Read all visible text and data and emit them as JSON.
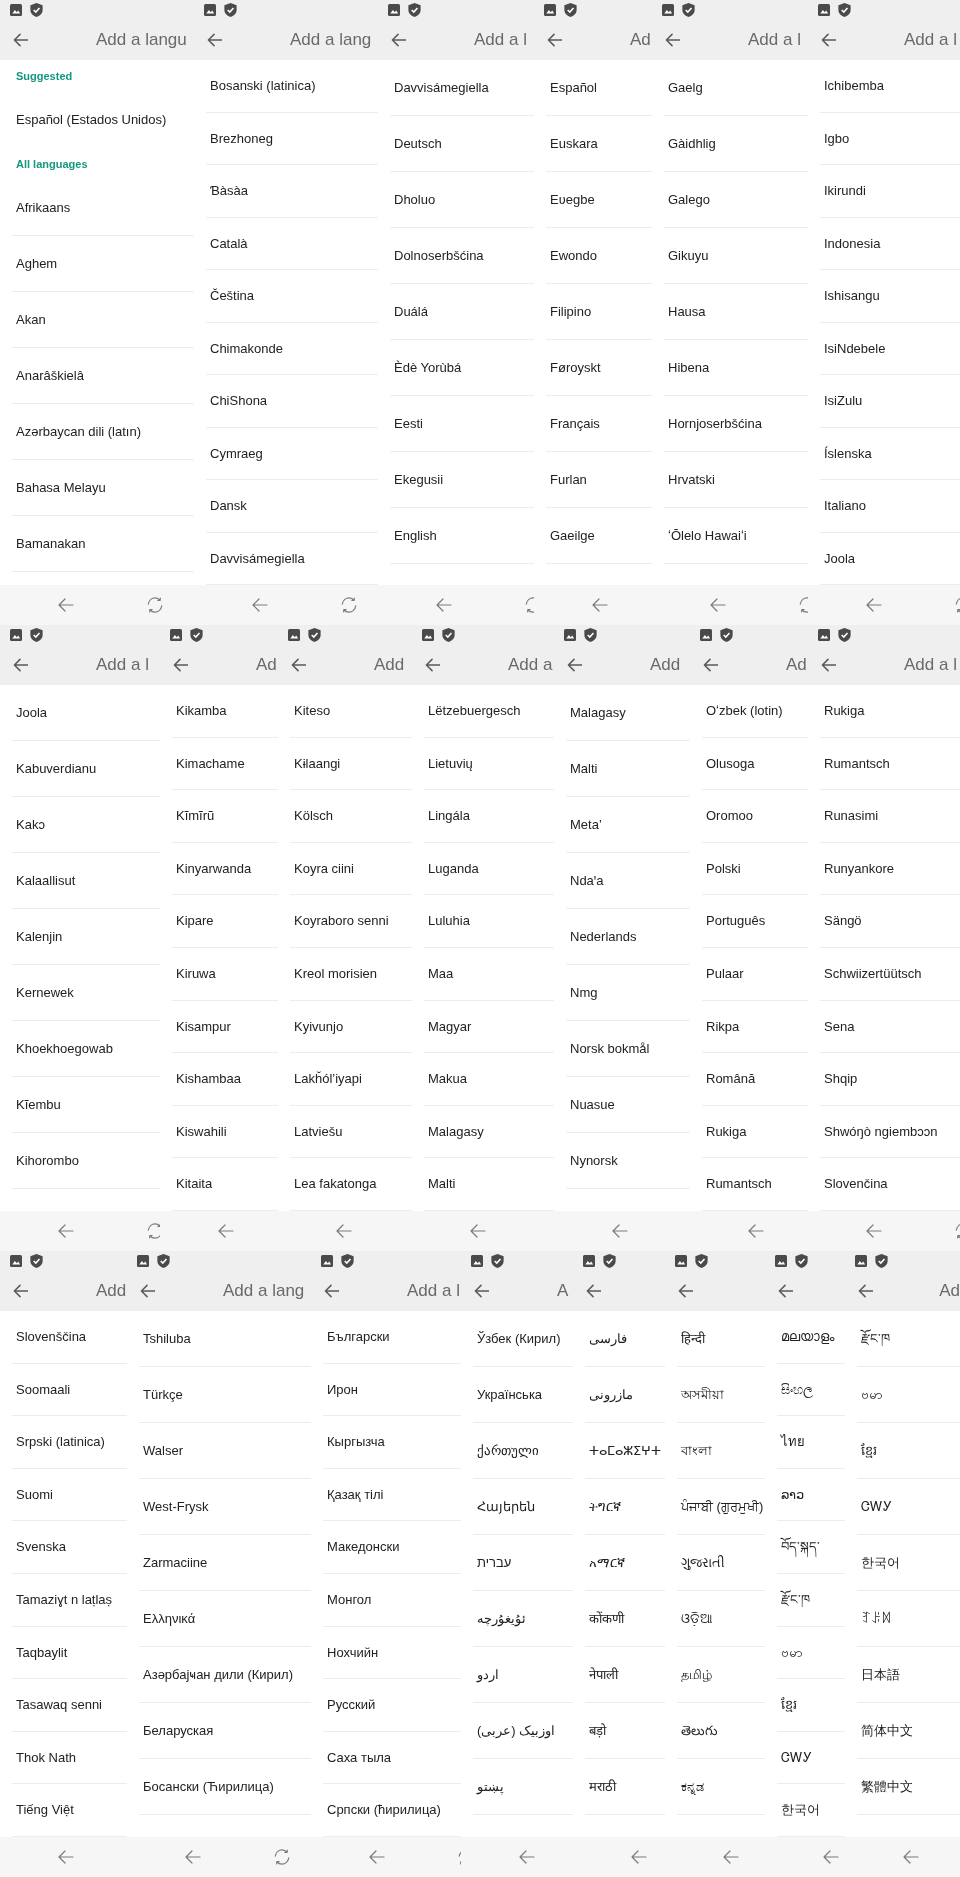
{
  "rows": [
    {
      "screens": [
        {
          "title": "Add a langu",
          "entries": [
            {
              "kind": "header",
              "text": "Suggested"
            },
            {
              "kind": "item",
              "text": "Español (Estados Unidos)"
            },
            {
              "kind": "header",
              "text": "All languages"
            },
            {
              "kind": "item",
              "text": "Afrikaans"
            },
            {
              "kind": "item",
              "text": "Aghem"
            },
            {
              "kind": "item",
              "text": "Akan"
            },
            {
              "kind": "item",
              "text": "Anarâškielâ"
            },
            {
              "kind": "item",
              "text": "Azərbaycan dili (latın)"
            },
            {
              "kind": "item",
              "text": "Bahasa Melayu"
            },
            {
              "kind": "item",
              "text": "Bamanakan"
            }
          ]
        },
        {
          "title": "Add a lang",
          "entries": [
            {
              "kind": "item",
              "text": "Bosanski (latinica)"
            },
            {
              "kind": "item",
              "text": "Brezhoneg"
            },
            {
              "kind": "item",
              "text": "Ɓàsàa"
            },
            {
              "kind": "item",
              "text": "Català"
            },
            {
              "kind": "item",
              "text": "Čeština"
            },
            {
              "kind": "item",
              "text": "Chimakonde"
            },
            {
              "kind": "item",
              "text": "ChiShona"
            },
            {
              "kind": "item",
              "text": "Cymraeg"
            },
            {
              "kind": "item",
              "text": "Dansk"
            },
            {
              "kind": "item",
              "text": "Davvisámegiella"
            }
          ]
        },
        {
          "title": "Add a l",
          "entries": [
            {
              "kind": "item",
              "text": "Davvisámegiella"
            },
            {
              "kind": "item",
              "text": "Deutsch"
            },
            {
              "kind": "item",
              "text": "Dholuo"
            },
            {
              "kind": "item",
              "text": "Dolnoserbšćina"
            },
            {
              "kind": "item",
              "text": "Duálá"
            },
            {
              "kind": "item",
              "text": "Èdè Yorùbá"
            },
            {
              "kind": "item",
              "text": "Eesti"
            },
            {
              "kind": "item",
              "text": "Ekegusii"
            },
            {
              "kind": "item",
              "text": "English"
            }
          ]
        },
        {
          "title": "Ad",
          "entries": [
            {
              "kind": "item",
              "text": "Español"
            },
            {
              "kind": "item",
              "text": "Euskara"
            },
            {
              "kind": "item",
              "text": "Eʋegbe"
            },
            {
              "kind": "item",
              "text": "Ewondo"
            },
            {
              "kind": "item",
              "text": "Filipino"
            },
            {
              "kind": "item",
              "text": "Føroyskt"
            },
            {
              "kind": "item",
              "text": "Français"
            },
            {
              "kind": "item",
              "text": "Furlan"
            },
            {
              "kind": "item",
              "text": "Gaeilge"
            }
          ]
        },
        {
          "title": "Add a l",
          "entries": [
            {
              "kind": "item",
              "text": "Gaelg"
            },
            {
              "kind": "item",
              "text": "Gàidhlig"
            },
            {
              "kind": "item",
              "text": "Galego"
            },
            {
              "kind": "item",
              "text": "Gikuyu"
            },
            {
              "kind": "item",
              "text": "Hausa"
            },
            {
              "kind": "item",
              "text": "Hibena"
            },
            {
              "kind": "item",
              "text": "Hornjoserbšćina"
            },
            {
              "kind": "item",
              "text": "Hrvatski"
            },
            {
              "kind": "item",
              "text": "ʻŌlelo Hawaiʻi"
            }
          ]
        },
        {
          "title": "Add a l",
          "entries": [
            {
              "kind": "item",
              "text": "Ichibemba"
            },
            {
              "kind": "item",
              "text": "Igbo"
            },
            {
              "kind": "item",
              "text": "Ikirundi"
            },
            {
              "kind": "item",
              "text": "Indonesia"
            },
            {
              "kind": "item",
              "text": "Ishisangu"
            },
            {
              "kind": "item",
              "text": "IsiNdebele"
            },
            {
              "kind": "item",
              "text": "IsiZulu"
            },
            {
              "kind": "item",
              "text": "Íslenska"
            },
            {
              "kind": "item",
              "text": "Italiano"
            },
            {
              "kind": "item",
              "text": "Joola"
            }
          ]
        }
      ]
    },
    {
      "screens": [
        {
          "title": "Add a l",
          "entries": [
            {
              "kind": "item",
              "text": "Joola"
            },
            {
              "kind": "item",
              "text": "Kabuverdianu"
            },
            {
              "kind": "item",
              "text": "Kakɔ"
            },
            {
              "kind": "item",
              "text": "Kalaallisut"
            },
            {
              "kind": "item",
              "text": "Kalenjin"
            },
            {
              "kind": "item",
              "text": "Kernewek"
            },
            {
              "kind": "item",
              "text": "Khoekhoegowab"
            },
            {
              "kind": "item",
              "text": "Kĩembu"
            },
            {
              "kind": "item",
              "text": "Kihorombo"
            }
          ]
        },
        {
          "title": "Ad",
          "entries": [
            {
              "kind": "item",
              "text": "Kikamba"
            },
            {
              "kind": "item",
              "text": "Kimachame"
            },
            {
              "kind": "item",
              "text": "Kĩmĩrũ"
            },
            {
              "kind": "item",
              "text": "Kinyarwanda"
            },
            {
              "kind": "item",
              "text": "Kipare"
            },
            {
              "kind": "item",
              "text": "Kiruwa"
            },
            {
              "kind": "item",
              "text": "Kisampur"
            },
            {
              "kind": "item",
              "text": "Kishambaa"
            },
            {
              "kind": "item",
              "text": "Kiswahili"
            },
            {
              "kind": "item",
              "text": "Kitaita"
            }
          ]
        },
        {
          "title": "Add",
          "entries": [
            {
              "kind": "item",
              "text": "Kiteso"
            },
            {
              "kind": "item",
              "text": "Kɨlaangi"
            },
            {
              "kind": "item",
              "text": "Kölsch"
            },
            {
              "kind": "item",
              "text": "Koyra ciini"
            },
            {
              "kind": "item",
              "text": "Koyraboro senni"
            },
            {
              "kind": "item",
              "text": "Kreol morisien"
            },
            {
              "kind": "item",
              "text": "Kyivunjo"
            },
            {
              "kind": "item",
              "text": "Lakȟólʼiyapi"
            },
            {
              "kind": "item",
              "text": "Latviešu"
            },
            {
              "kind": "item",
              "text": "Lea fakatonga"
            }
          ]
        },
        {
          "title": "Add a",
          "entries": [
            {
              "kind": "item",
              "text": "Lëtzebuergesch"
            },
            {
              "kind": "item",
              "text": "Lietuvių"
            },
            {
              "kind": "item",
              "text": "Lingála"
            },
            {
              "kind": "item",
              "text": "Luganda"
            },
            {
              "kind": "item",
              "text": "Luluhia"
            },
            {
              "kind": "item",
              "text": "Maa"
            },
            {
              "kind": "item",
              "text": "Magyar"
            },
            {
              "kind": "item",
              "text": "Makua"
            },
            {
              "kind": "item",
              "text": "Malagasy"
            },
            {
              "kind": "item",
              "text": "Malti"
            }
          ]
        },
        {
          "title": "Add",
          "entries": [
            {
              "kind": "item",
              "text": "Malagasy"
            },
            {
              "kind": "item",
              "text": "Malti"
            },
            {
              "kind": "item",
              "text": "Metaʼ"
            },
            {
              "kind": "item",
              "text": "Ndaꞌa"
            },
            {
              "kind": "item",
              "text": "Nederlands"
            },
            {
              "kind": "item",
              "text": "Nmg"
            },
            {
              "kind": "item",
              "text": "Norsk bokmål"
            },
            {
              "kind": "item",
              "text": "Nuasue"
            },
            {
              "kind": "item",
              "text": "Nynorsk"
            }
          ]
        },
        {
          "title": "Ad",
          "entries": [
            {
              "kind": "item",
              "text": "Oʻzbek (lotin)"
            },
            {
              "kind": "item",
              "text": "Olusoga"
            },
            {
              "kind": "item",
              "text": "Oromoo"
            },
            {
              "kind": "item",
              "text": "Polski"
            },
            {
              "kind": "item",
              "text": "Português"
            },
            {
              "kind": "item",
              "text": "Pulaar"
            },
            {
              "kind": "item",
              "text": "Rikpa"
            },
            {
              "kind": "item",
              "text": "Română"
            },
            {
              "kind": "item",
              "text": "Rukiga"
            },
            {
              "kind": "item",
              "text": "Rumantsch"
            }
          ]
        },
        {
          "title": "Add a l",
          "entries": [
            {
              "kind": "item",
              "text": "Rukiga"
            },
            {
              "kind": "item",
              "text": "Rumantsch"
            },
            {
              "kind": "item",
              "text": "Runasimi"
            },
            {
              "kind": "item",
              "text": "Runyankore"
            },
            {
              "kind": "item",
              "text": "Sängö"
            },
            {
              "kind": "item",
              "text": "Schwiizertüütsch"
            },
            {
              "kind": "item",
              "text": "Sena"
            },
            {
              "kind": "item",
              "text": "Shqip"
            },
            {
              "kind": "item",
              "text": "Shwóŋò ngiembɔɔn"
            },
            {
              "kind": "item",
              "text": "Slovenčina"
            }
          ]
        }
      ]
    },
    {
      "screens": [
        {
          "title": "Add",
          "entries": [
            {
              "kind": "item",
              "text": "Slovenščina"
            },
            {
              "kind": "item",
              "text": "Soomaali"
            },
            {
              "kind": "item",
              "text": "Srpski (latinica)"
            },
            {
              "kind": "item",
              "text": "Suomi"
            },
            {
              "kind": "item",
              "text": "Svenska"
            },
            {
              "kind": "item",
              "text": "Tamaziɣt n laṭlaṣ"
            },
            {
              "kind": "item",
              "text": "Taqbaylit"
            },
            {
              "kind": "item",
              "text": "Tasawaq senni"
            },
            {
              "kind": "item",
              "text": "Thok Nath"
            },
            {
              "kind": "item",
              "text": "Tiếng Việt"
            }
          ]
        },
        {
          "title": "Add a lang",
          "entries": [
            {
              "kind": "item",
              "text": "Tshiluba"
            },
            {
              "kind": "item",
              "text": "Türkçe"
            },
            {
              "kind": "item",
              "text": "Walser"
            },
            {
              "kind": "item",
              "text": "West-Frysk"
            },
            {
              "kind": "item",
              "text": "Zarmaciine"
            },
            {
              "kind": "item",
              "text": "Ελληνικά"
            },
            {
              "kind": "item",
              "text": "Азәрбајҹан дили (Кирил)"
            },
            {
              "kind": "item",
              "text": "Беларуская"
            },
            {
              "kind": "item",
              "text": "Босански (Ћирилица)"
            }
          ]
        },
        {
          "title": "Add a l",
          "entries": [
            {
              "kind": "item",
              "text": "Български"
            },
            {
              "kind": "item",
              "text": "Ирон"
            },
            {
              "kind": "item",
              "text": "Кыргызча"
            },
            {
              "kind": "item",
              "text": "Қазақ тілі"
            },
            {
              "kind": "item",
              "text": "Македонски"
            },
            {
              "kind": "item",
              "text": "Монгол"
            },
            {
              "kind": "item",
              "text": "Нохчийн"
            },
            {
              "kind": "item",
              "text": "Русский"
            },
            {
              "kind": "item",
              "text": "Саха тыла"
            },
            {
              "kind": "item",
              "text": "Српски (ћирилица)"
            }
          ]
        },
        {
          "title": "A",
          "entries": [
            {
              "kind": "item",
              "text": "Ўзбек (Кирил)"
            },
            {
              "kind": "item",
              "text": "Українська"
            },
            {
              "kind": "item",
              "text": "ქართული"
            },
            {
              "kind": "item",
              "text": "Հայերեն"
            },
            {
              "kind": "item",
              "text": "עברית"
            },
            {
              "kind": "item",
              "text": "ئۇيغۇرچە"
            },
            {
              "kind": "item",
              "text": "اردو"
            },
            {
              "kind": "item",
              "text": "اوزبیک (عربی)"
            },
            {
              "kind": "item",
              "text": "پښتو"
            }
          ]
        },
        {
          "entries": [
            {
              "kind": "item",
              "text": "فارسی"
            },
            {
              "kind": "item",
              "text": "مازرونی"
            },
            {
              "kind": "item",
              "text": "ⵜⴰⵎⴰⵣⵉⵖⵜ"
            },
            {
              "kind": "item",
              "text": "ትግርኛ"
            },
            {
              "kind": "item",
              "text": "አማርኛ"
            },
            {
              "kind": "item",
              "text": "कोंकणी"
            },
            {
              "kind": "item",
              "text": "नेपाली"
            },
            {
              "kind": "item",
              "text": "बड़ो"
            },
            {
              "kind": "item",
              "text": "मराठी"
            }
          ]
        },
        {
          "entries": [
            {
              "kind": "item",
              "text": "हिन्दी"
            },
            {
              "kind": "item",
              "text": "অসমীয়া"
            },
            {
              "kind": "item",
              "text": "বাংলা"
            },
            {
              "kind": "item",
              "text": "ਪੰਜਾਬੀ (ਗੁਰਮੁਖੀ)"
            },
            {
              "kind": "item",
              "text": "ગુજરાતી"
            },
            {
              "kind": "item",
              "text": "ଓଡ଼ିଆ"
            },
            {
              "kind": "item",
              "text": "தமிழ்"
            },
            {
              "kind": "item",
              "text": "తెలుగు"
            },
            {
              "kind": "item",
              "text": "ಕನ್ನಡ"
            }
          ]
        },
        {
          "entries": [
            {
              "kind": "item",
              "text": "മലയാളം"
            },
            {
              "kind": "item",
              "text": "සිංහල"
            },
            {
              "kind": "item",
              "text": "ไทย"
            },
            {
              "kind": "item",
              "text": "ລາວ"
            },
            {
              "kind": "item",
              "text": "བོད་སྐད་"
            },
            {
              "kind": "item",
              "text": "རྫོང་ཁ"
            },
            {
              "kind": "item",
              "text": "ဗမာ"
            },
            {
              "kind": "item",
              "text": "ខ្មែរ"
            },
            {
              "kind": "item",
              "text": "ᏣᎳᎩ"
            },
            {
              "kind": "item",
              "text": "한국어"
            }
          ]
        },
        {
          "title": "Ad",
          "entries": [
            {
              "kind": "item",
              "text": "རྫོང་ཁ"
            },
            {
              "kind": "item",
              "text": "ဗမာ"
            },
            {
              "kind": "item",
              "text": "ខ្មែរ"
            },
            {
              "kind": "item",
              "text": "ᏣᎳᎩ"
            },
            {
              "kind": "item",
              "text": "한국어"
            },
            {
              "kind": "item",
              "text": "ꆈꌠꉙ"
            },
            {
              "kind": "item",
              "text": "日本語"
            },
            {
              "kind": "item",
              "text": "简体中文"
            },
            {
              "kind": "item",
              "text": "繁體中文"
            }
          ]
        }
      ]
    }
  ]
}
